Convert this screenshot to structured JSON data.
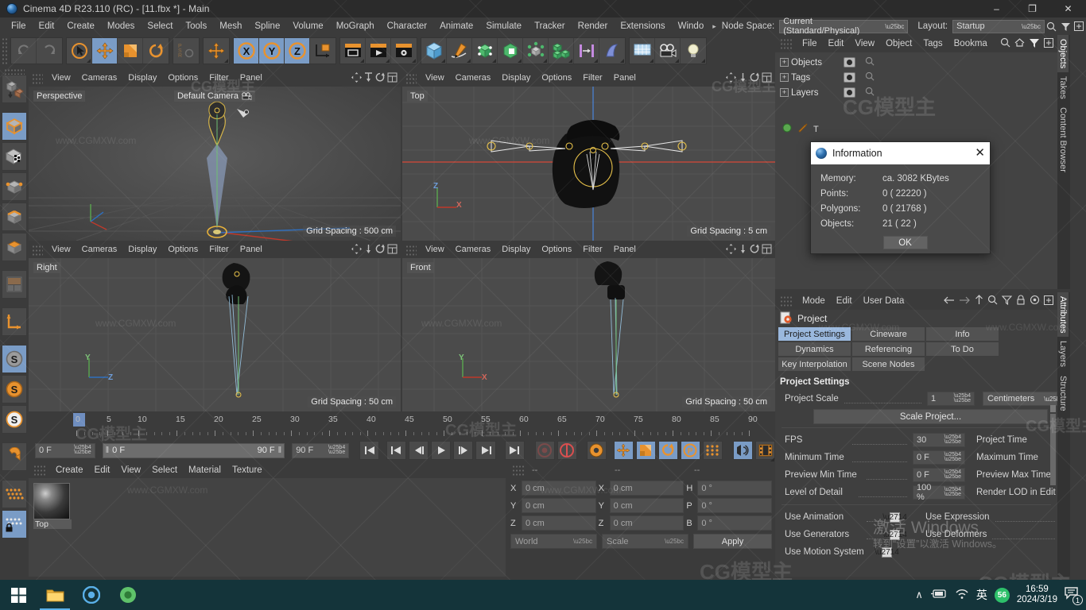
{
  "titlebar": {
    "title": "Cinema 4D R23.110 (RC) - [11.fbx *] - Main",
    "minimize": "–",
    "maximize": "❐",
    "close": "✕"
  },
  "menubar": {
    "items": [
      "File",
      "Edit",
      "Create",
      "Modes",
      "Select",
      "Tools",
      "Mesh",
      "Spline",
      "Volume",
      "MoGraph",
      "Character",
      "Animate",
      "Simulate",
      "Tracker",
      "Render",
      "Extensions",
      "Windo"
    ],
    "overflow_arrow": "▸",
    "node_space_label": "Node Space:",
    "node_space_value": "Current (Standard/Physical)",
    "layout_label": "Layout:",
    "layout_value": "Startup",
    "search_icon": "search-icon"
  },
  "viewports": [
    {
      "name": "Perspective",
      "menus": [
        "View",
        "Cameras",
        "Display",
        "Options",
        "Filter",
        "Panel"
      ],
      "camera": "Default Camera",
      "grid_spacing": "Grid Spacing : 500 cm",
      "axes": [
        "Y",
        "Z",
        "X"
      ]
    },
    {
      "name": "Top",
      "menus": [
        "View",
        "Cameras",
        "Display",
        "Options",
        "Filter",
        "Panel"
      ],
      "camera": "",
      "grid_spacing": "Grid Spacing : 5 cm",
      "axes": [
        "Z",
        "X"
      ]
    },
    {
      "name": "Right",
      "menus": [
        "View",
        "Cameras",
        "Display",
        "Options",
        "Filter",
        "Panel"
      ],
      "camera": "",
      "grid_spacing": "Grid Spacing : 50 cm",
      "axes": [
        "Y",
        "Z"
      ]
    },
    {
      "name": "Front",
      "menus": [
        "View",
        "Cameras",
        "Display",
        "Options",
        "Filter",
        "Panel"
      ],
      "camera": "",
      "grid_spacing": "Grid Spacing : 50 cm",
      "axes": [
        "Y",
        "X"
      ]
    }
  ],
  "timeline": {
    "ticks": [
      "0",
      "5",
      "10",
      "15",
      "20",
      "25",
      "30",
      "35",
      "40",
      "45",
      "50",
      "55",
      "60",
      "65",
      "70",
      "75",
      "80",
      "85",
      "90"
    ],
    "current_frame": "0 F",
    "range_start": "0 F",
    "range_end": "90 F",
    "end_frame": "90 F",
    "preview_field": "0 F"
  },
  "material_manager": {
    "menus": [
      "Create",
      "Edit",
      "View",
      "Select",
      "Material",
      "Texture"
    ],
    "materials": [
      {
        "name": "Top"
      }
    ]
  },
  "coordinates": {
    "header_dashes": [
      "--",
      "--",
      "--"
    ],
    "position": {
      "label_x": "X",
      "label_y": "Y",
      "label_z": "Z",
      "x": "0 cm",
      "y": "0 cm",
      "z": "0 cm"
    },
    "size": {
      "label_x": "X",
      "label_y": "Y",
      "label_z": "Z",
      "x": "0 cm",
      "y": "0 cm",
      "z": "0 cm"
    },
    "rotation": {
      "label_h": "H",
      "label_p": "P",
      "label_b": "B",
      "h": "0 °",
      "p": "0 °",
      "b": "0 °"
    },
    "system": "World",
    "mode": "Scale",
    "apply": "Apply"
  },
  "object_manager": {
    "menus": [
      "File",
      "Edit",
      "View",
      "Object",
      "Tags",
      "Bookma"
    ],
    "rows": [
      {
        "expand": "+",
        "name": "Objects"
      },
      {
        "expand": "+",
        "name": "Tags"
      },
      {
        "expand": "+",
        "name": "Layers"
      }
    ],
    "dock_tabs": [
      "Objects",
      "Takes",
      "Content Browser"
    ]
  },
  "attribute_manager": {
    "menus": [
      "Mode",
      "Edit",
      "User Data"
    ],
    "object_title": "Project",
    "tabs_row1": [
      "Project Settings",
      "Cineware",
      "Info"
    ],
    "tabs_row2": [
      "Dynamics",
      "Referencing",
      "To Do"
    ],
    "tabs_row3": [
      "Key Interpolation",
      "Scene Nodes"
    ],
    "selected_tab": "Project Settings",
    "section_title": "Project Settings",
    "fields": {
      "project_scale_label": "Project Scale",
      "project_scale_value": "1",
      "project_scale_unit": "Centimeters",
      "scale_project_button": "Scale Project...",
      "fps_label": "FPS",
      "fps_value": "30",
      "project_time_label": "Project Time",
      "minimum_time_label": "Minimum Time",
      "minimum_time_value": "0 F",
      "maximum_time_label": "Maximum Time",
      "preview_min_label": "Preview Min Time",
      "preview_min_value": "0 F",
      "preview_max_label": "Preview Max Time",
      "lod_label": "Level of Detail",
      "lod_value": "100 %",
      "render_lod_label": "Render LOD in Edit",
      "use_animation_label": "Use Animation",
      "use_expression_label": "Use Expression",
      "use_generators_label": "Use Generators",
      "use_deformers_label": "Use Deformers",
      "use_motion_label": "Use Motion System"
    },
    "dock_tabs": [
      "Attributes",
      "Layers",
      "Structure"
    ]
  },
  "info_dialog": {
    "title": "Information",
    "close": "✕",
    "rows": [
      {
        "key": "Memory:",
        "value": "ca. 3082 KBytes"
      },
      {
        "key": "Points:",
        "value": "0 ( 22220 )"
      },
      {
        "key": "Polygons:",
        "value": "0 ( 21768 )"
      },
      {
        "key": "Objects:",
        "value": "21 ( 22 )"
      }
    ],
    "ok": "OK"
  },
  "taskbar": {
    "time": "16:59",
    "date": "2024/3/19",
    "ime": "英",
    "badge": "56",
    "notification_count": "1",
    "chevron": "∧"
  },
  "watermarks": {
    "site": "www.CGMXW.com",
    "brand": "CG模型主",
    "windows_line1": "激活 Windows",
    "windows_line2": "转到“设置”以激活 Windows。"
  },
  "colors": {
    "accent_orange": "#e8922e",
    "accent_blue": "#7a9cc6",
    "panel_bg": "#3b3b3b",
    "viewport_bg": "#4b4b4b",
    "taskbar_bg": "#14343a"
  }
}
